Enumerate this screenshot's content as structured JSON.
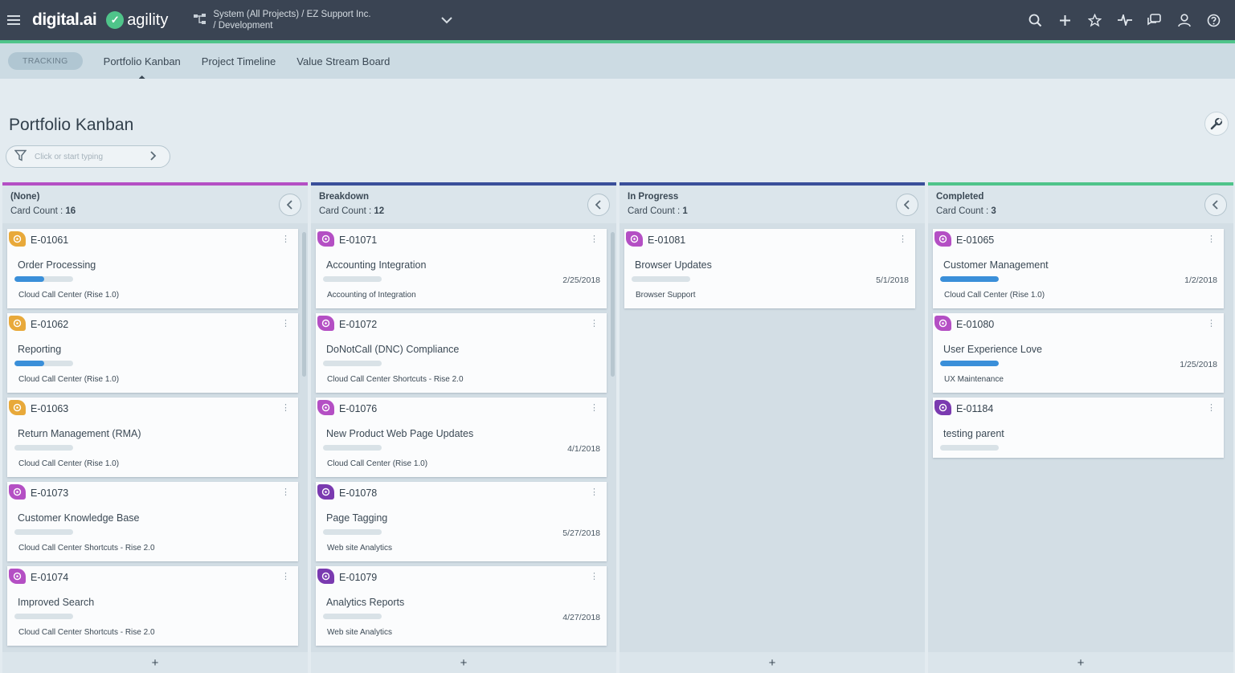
{
  "header": {
    "logo": "digital.ai",
    "product": "agility",
    "project_path": "System (All Projects) / EZ Support Inc. / Development",
    "icons": [
      "search-icon",
      "plus-icon",
      "star-icon",
      "pulse-icon",
      "chat-icon",
      "user-icon",
      "help-icon"
    ]
  },
  "nav": {
    "section": "TRACKING",
    "tabs": [
      {
        "label": "Portfolio Kanban",
        "active": true
      },
      {
        "label": "Project Timeline",
        "active": false
      },
      {
        "label": "Value Stream Board",
        "active": false
      }
    ]
  },
  "page": {
    "title": "Portfolio Kanban",
    "filter_placeholder": "Click or start typing"
  },
  "board": {
    "count_label": "Card Count : ",
    "columns": [
      {
        "name": "(None)",
        "count": "16",
        "accent": "#b44fc4",
        "cards": [
          {
            "id": "E-01061",
            "title": "Order Processing",
            "date": "",
            "project": "Cloud Call Center (Rise 1.0)",
            "progress": 0.5,
            "badge": "#e8a93a"
          },
          {
            "id": "E-01062",
            "title": "Reporting",
            "date": "",
            "project": "Cloud Call Center (Rise 1.0)",
            "progress": 0.5,
            "badge": "#e8a93a"
          },
          {
            "id": "E-01063",
            "title": "Return Management (RMA)",
            "date": "",
            "project": "Cloud Call Center (Rise 1.0)",
            "progress": 0,
            "badge": "#e8a93a"
          },
          {
            "id": "E-01073",
            "title": "Customer Knowledge Base",
            "date": "",
            "project": "Cloud Call Center Shortcuts - Rise 2.0",
            "progress": 0,
            "badge": "#b44fc4"
          },
          {
            "id": "E-01074",
            "title": "Improved Search",
            "date": "",
            "project": "Cloud Call Center Shortcuts - Rise 2.0",
            "progress": 0,
            "badge": "#b44fc4"
          }
        ]
      },
      {
        "name": "Breakdown",
        "count": "12",
        "accent": "#3a4f9a",
        "cards": [
          {
            "id": "E-01071",
            "title": "Accounting Integration",
            "date": "2/25/2018",
            "project": "Accounting of Integration",
            "progress": 0,
            "badge": "#b44fc4"
          },
          {
            "id": "E-01072",
            "title": "DoNotCall (DNC) Compliance",
            "date": "",
            "project": "Cloud Call Center Shortcuts - Rise 2.0",
            "progress": 0,
            "badge": "#b44fc4"
          },
          {
            "id": "E-01076",
            "title": "New Product Web Page Updates",
            "date": "4/1/2018",
            "project": "Cloud Call Center (Rise 1.0)",
            "progress": 0,
            "badge": "#b44fc4"
          },
          {
            "id": "E-01078",
            "title": "Page Tagging",
            "date": "5/27/2018",
            "project": "Web site Analytics",
            "progress": 0,
            "badge": "#7a3ab0"
          },
          {
            "id": "E-01079",
            "title": "Analytics Reports",
            "date": "4/27/2018",
            "project": "Web site Analytics",
            "progress": 0,
            "badge": "#7a3ab0"
          }
        ]
      },
      {
        "name": "In Progress",
        "count": "1",
        "accent": "#3a4f9a",
        "cards": [
          {
            "id": "E-01081",
            "title": "Browser Updates",
            "date": "5/1/2018",
            "project": "Browser Support",
            "progress": 0,
            "badge": "#b44fc4"
          }
        ]
      },
      {
        "name": "Completed",
        "count": "3",
        "accent": "#4fc48a",
        "cards": [
          {
            "id": "E-01065",
            "title": "Customer Management",
            "date": "1/2/2018",
            "project": "Cloud Call Center (Rise 1.0)",
            "progress": 1,
            "badge": "#b44fc4"
          },
          {
            "id": "E-01080",
            "title": "User Experience Love",
            "date": "1/25/2018",
            "project": "UX Maintenance",
            "progress": 1,
            "badge": "#b44fc4"
          },
          {
            "id": "E-01184",
            "title": "testing parent",
            "date": "",
            "project": "",
            "progress": 0,
            "badge": "#7a3ab0"
          }
        ]
      }
    ]
  }
}
